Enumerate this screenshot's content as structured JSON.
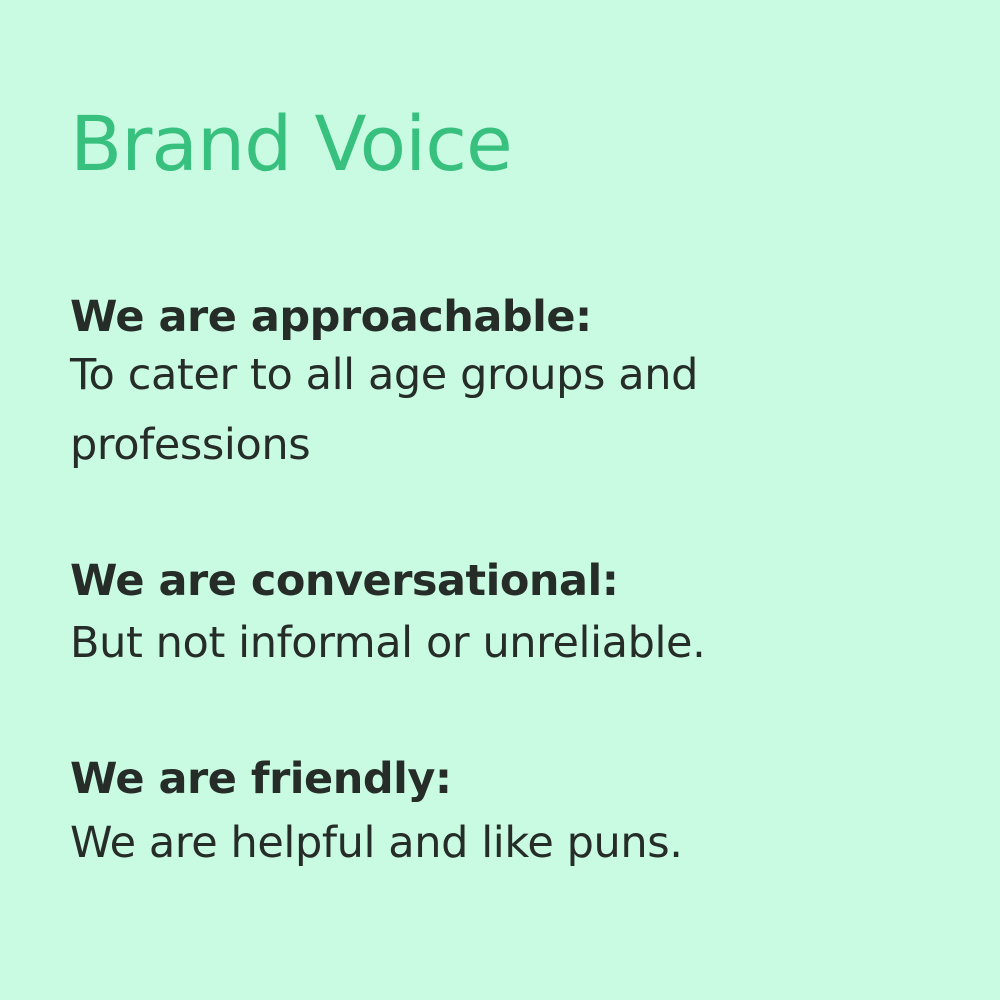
{
  "colors": {
    "background": "#c8fbe1",
    "title": "#38c07f",
    "text": "#262c28"
  },
  "title": "Brand Voice",
  "sections": [
    {
      "heading": "We are approachable:",
      "body": "To cater to all age groups and professions"
    },
    {
      "heading": "We are conversational:",
      "body": "But not informal or unreliable."
    },
    {
      "heading": "We are friendly:",
      "body": "We are helpful and like puns."
    }
  ]
}
